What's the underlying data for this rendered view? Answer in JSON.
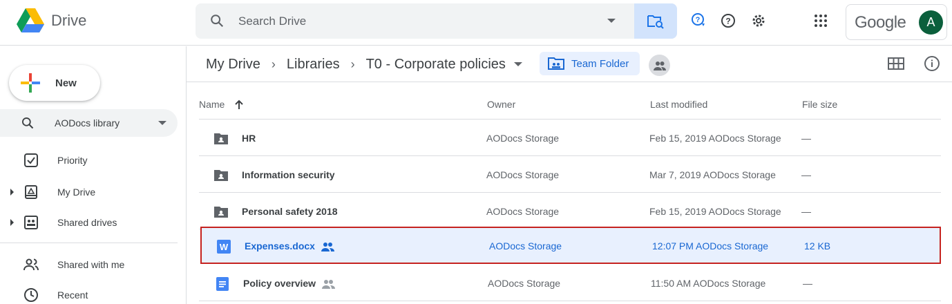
{
  "app": {
    "name": "Drive"
  },
  "search": {
    "placeholder": "Search Drive"
  },
  "account": {
    "brand": "Google",
    "avatar_initial": "A"
  },
  "sidebar": {
    "new_label": "New",
    "library_selector": "AODocs library",
    "items": [
      {
        "label": "Priority",
        "icon": "priority-check-icon"
      },
      {
        "label": "My Drive",
        "icon": "my-drive-icon"
      },
      {
        "label": "Shared drives",
        "icon": "shared-drives-icon"
      },
      {
        "label": "Shared with me",
        "icon": "shared-with-me-icon"
      },
      {
        "label": "Recent",
        "icon": "clock-icon"
      }
    ]
  },
  "breadcrumb": [
    "My Drive",
    "Libraries",
    "T0 - Corporate policies"
  ],
  "team_folder_label": "Team Folder",
  "table": {
    "columns": {
      "name": "Name",
      "owner": "Owner",
      "modified": "Last modified",
      "size": "File size"
    },
    "rows": [
      {
        "name": "HR",
        "type": "shared-folder",
        "owner": "AODocs Storage",
        "modified": "Feb 15, 2019  AODocs Storage",
        "size": "—",
        "shared": false,
        "selected": false
      },
      {
        "name": "Information security",
        "type": "shared-folder",
        "owner": "AODocs Storage",
        "modified": "Mar 7, 2019  AODocs Storage",
        "size": "—",
        "shared": false,
        "selected": false
      },
      {
        "name": "Personal safety 2018",
        "type": "shared-folder",
        "owner": "AODocs Storage",
        "modified": "Feb 15, 2019  AODocs Storage",
        "size": "—",
        "shared": false,
        "selected": false
      },
      {
        "name": "Expenses.docx",
        "type": "word",
        "owner": "AODocs Storage",
        "modified": "12:07 PM  AODocs Storage",
        "size": "12 KB",
        "shared": true,
        "selected": true
      },
      {
        "name": "Policy overview",
        "type": "gdoc",
        "owner": "AODocs Storage",
        "modified": "11:50 AM  AODocs Storage",
        "size": "—",
        "shared": true,
        "selected": false
      }
    ]
  },
  "colors": {
    "accent": "#1a73e8",
    "selected_bg": "#e8f0fe",
    "selected_border": "#c5221f"
  }
}
